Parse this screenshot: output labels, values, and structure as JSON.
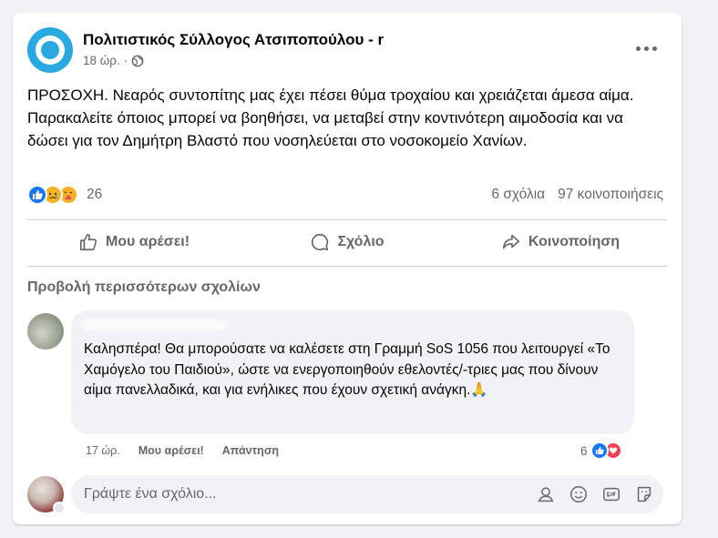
{
  "post": {
    "page_name": "Πολιτιστικός Σύλλογος Ατσιποπούλου - r",
    "time": "18 ώρ.",
    "separator": "·",
    "text": "ΠΡΟΣΟΧΗ. Νεαρός συντοπίτης μας έχει πέσει θύμα τροχαίου και χρειάζεται άμεσα αίμα. Παρακαλείτε όποιος μπορεί να βοηθήσει, να μεταβεί στην κοντινότερη αιμοδοσία και να δώσει για τον Δημήτρη Βλαστό που νοσηλεύεται στο νοσοκομείο Χανίων.",
    "reaction_count": "26",
    "comments_count": "6 σχόλια",
    "shares_count": "97 κοινοποιήσεις"
  },
  "actions": {
    "like": "Μου αρέσει!",
    "comment": "Σχόλιο",
    "share": "Κοινοποίηση"
  },
  "more_comments": "Προβολή περισσότερων σχολίων",
  "comment": {
    "text": "Καλησπέρα! Θα μπορούσατε να καλέσετε στη Γραμμή SoS 1056 που λειτουργεί «Το Χαμόγελο του Παιδιού», ώστε να ενεργοποιηθούν εθελοντές/-τριες μας που δίνουν αίμα πανελλαδικά, και για ενήλικες που έχουν σχετική ανάγκη.🙏",
    "time": "17 ώρ.",
    "like": "Μου αρέσει!",
    "reply": "Απάντηση",
    "reaction_count": "6"
  },
  "composer": {
    "placeholder": "Γράψτε ένα σχόλιο..."
  },
  "colors": {
    "accent": "#1877f2",
    "avatar_blue": "#29a9e0",
    "love": "#f33e58"
  }
}
